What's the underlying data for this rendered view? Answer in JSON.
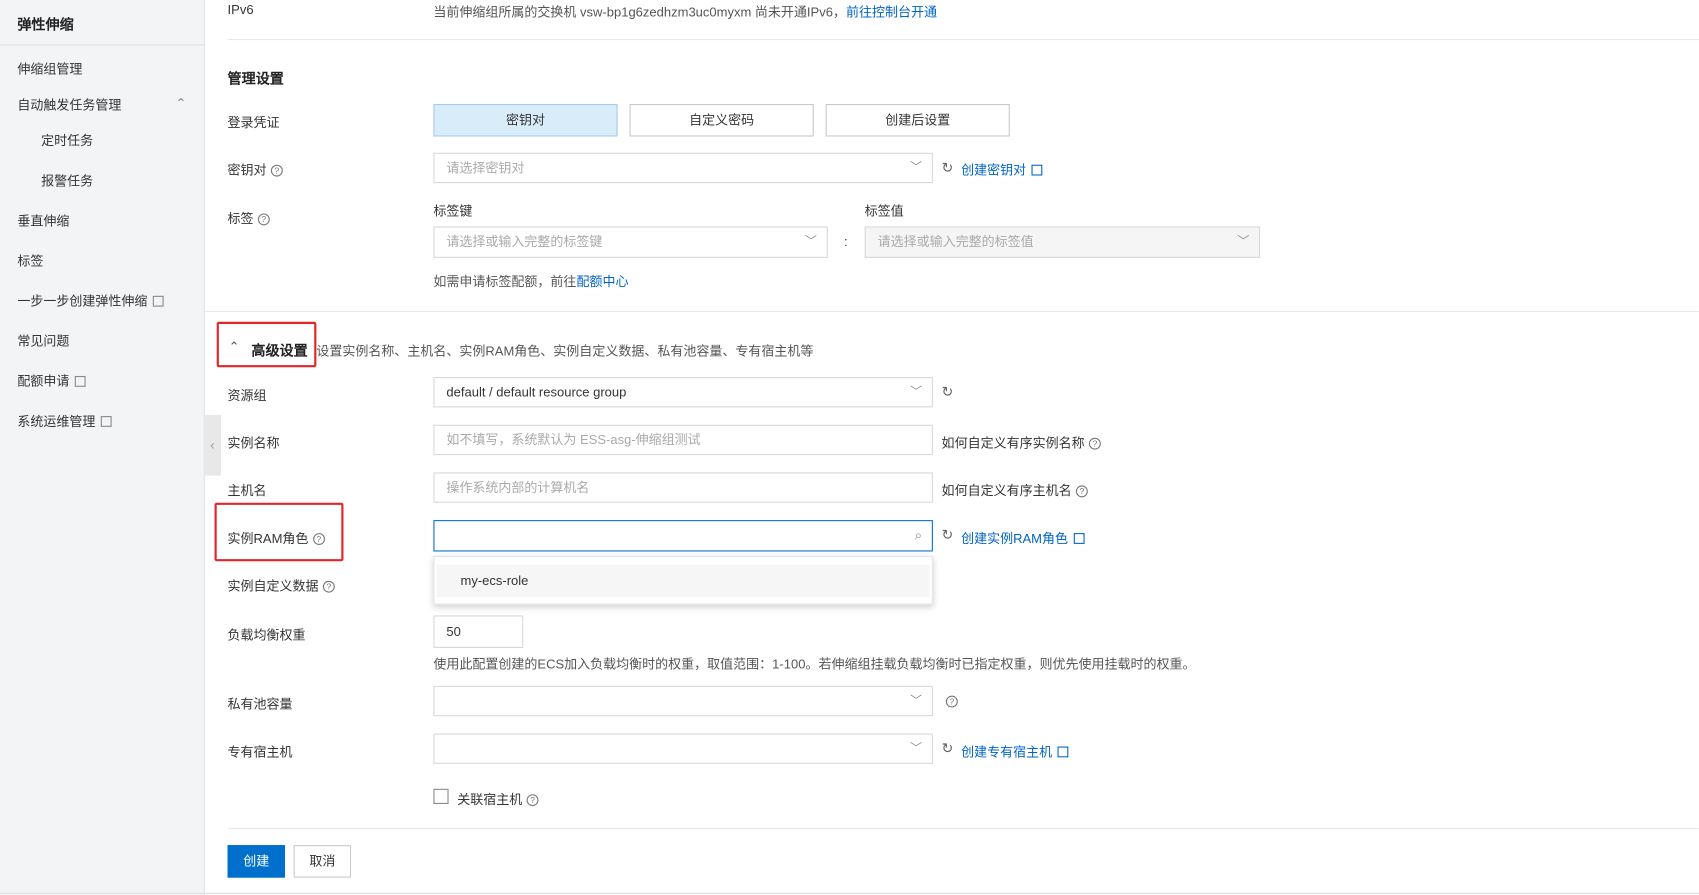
{
  "sidebar": {
    "title": "弹性伸缩",
    "items": [
      {
        "label": "伸缩组管理"
      },
      {
        "label": "自动触发任务管理"
      },
      {
        "label": "定时任务"
      },
      {
        "label": "报警任务"
      },
      {
        "label": "垂直伸缩"
      },
      {
        "label": "标签"
      },
      {
        "label": "一步一步创建弹性伸缩"
      },
      {
        "label": "常见问题"
      },
      {
        "label": "配额申请"
      },
      {
        "label": "系统运维管理"
      }
    ]
  },
  "top": {
    "label": "IPv6",
    "text": "当前伸缩组所属的交换机 vsw-bp1g6zedhzm3uc0myxm 尚未开通IPv6，",
    "link": "前往控制台开通"
  },
  "manage": {
    "title": "管理设置",
    "login_label": "登录凭证",
    "login_options": [
      "密钥对",
      "自定义密码",
      "创建后设置"
    ],
    "keypair_label": "密钥对",
    "keypair_placeholder": "请选择密钥对",
    "create_keypair": "创建密钥对",
    "tag_label": "标签",
    "tag_key_header": "标签键",
    "tag_value_header": "标签值",
    "tag_key_placeholder": "请选择或输入完整的标签键",
    "tag_value_placeholder": "请选择或输入完整的标签值",
    "colon": ":",
    "quota_hint": "如需申请标签配额，前往",
    "quota_link": "配额中心"
  },
  "advanced": {
    "title": "高级设置",
    "desc": "设置实例名称、主机名、实例RAM角色、实例自定义数据、私有池容量、专有宿主机等",
    "resource_group_label": "资源组",
    "resource_group_value": "default / default resource group",
    "instance_name_label": "实例名称",
    "instance_name_placeholder": "如不填写，系统默认为 ESS-asg-伸缩组测试",
    "instance_name_help": "如何自定义有序实例名称",
    "hostname_label": "主机名",
    "hostname_placeholder": "操作系统内部的计算机名",
    "hostname_help": "如何自定义有序主机名",
    "ram_label": "实例RAM角色",
    "ram_value": "",
    "create_ram": "创建实例RAM角色",
    "ram_options": [
      "my-ecs-role"
    ],
    "userdata_label": "实例自定义数据",
    "weight_label": "负载均衡权重",
    "weight_value": "50",
    "weight_hint": "使用此配置创建的ECS加入负载均衡时的权重，取值范围：1-100。若伸缩组挂载负载均衡时已指定权重，则优先使用挂载时的权重。",
    "pool_label": "私有池容量",
    "dedicated_label": "专有宿主机",
    "create_dedicated": "创建专有宿主机",
    "link_host_label": "关联宿主机",
    "link_host_checked": false
  },
  "footer": {
    "create": "创建",
    "cancel": "取消"
  },
  "colors": {
    "accent": "#0064c8",
    "primary_button": "#0070cc",
    "highlight": "#e0262a"
  }
}
